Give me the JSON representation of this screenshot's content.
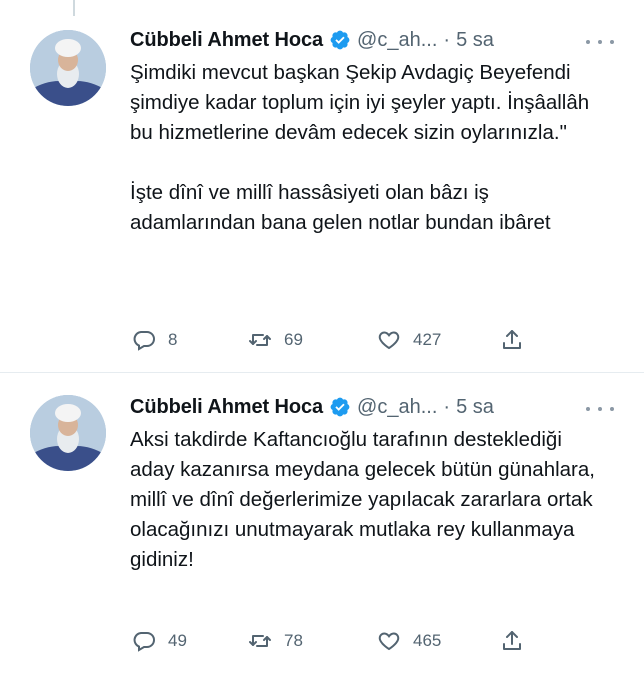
{
  "tweets": [
    {
      "author_name": "Cübbeli Ahmet Hoca",
      "handle": "@c_ah...",
      "separator": "·",
      "time": "5 sa",
      "text": "Şimdiki mevcut başkan Şekip Avdagiç Beyefendi şimdiye kadar toplum için iyi şeyler yaptı. İnşâallâh bu hizmetlerine devâm edecek sizin oylarınızla.\"\n\nİşte dînî ve millî hassâsiyeti olan bâzı iş adamlarından bana gelen notlar bundan ibâret",
      "replies": "8",
      "retweets": "69",
      "likes": "427"
    },
    {
      "author_name": "Cübbeli Ahmet Hoca",
      "handle": "@c_ah...",
      "separator": "·",
      "time": "5 sa",
      "text": "Aksi takdirde Kaftancıoğlu tarafının desteklediği aday kazanırsa meydana gelecek bütün günahlara, millî ve dînî değerlerimize yapılacak zararlara ortak olacağınızı unutmayarak mutlaka rey kullanmaya gidiniz!",
      "replies": "49",
      "retweets": "78",
      "likes": "465"
    }
  ],
  "colors": {
    "verified": "#1d9bf0",
    "secondary_text": "#536471",
    "primary_text": "#0f1419"
  },
  "icons": [
    "reply-icon",
    "retweet-icon",
    "like-icon",
    "share-icon",
    "verified-badge-icon",
    "more-options-icon"
  ]
}
